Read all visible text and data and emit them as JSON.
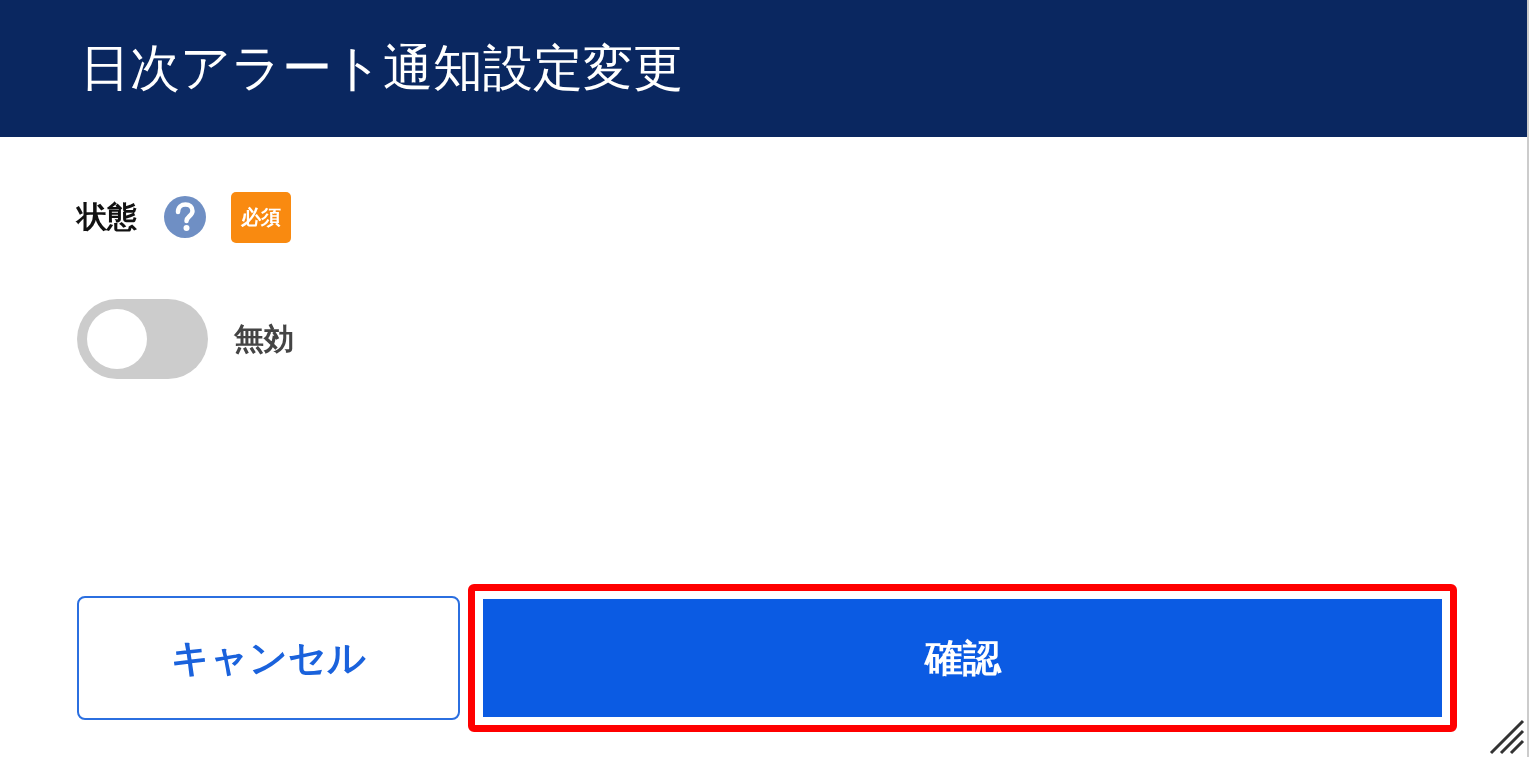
{
  "dialog": {
    "title": "日次アラート通知設定変更"
  },
  "field": {
    "label": "状態",
    "help": true,
    "required_badge": "必須"
  },
  "toggle": {
    "on": false,
    "label": "無効"
  },
  "buttons": [
    {
      "label": "キャンセル",
      "kind": "secondary",
      "highlighted": false
    },
    {
      "label": "確認",
      "kind": "primary",
      "highlighted": true
    }
  ]
}
